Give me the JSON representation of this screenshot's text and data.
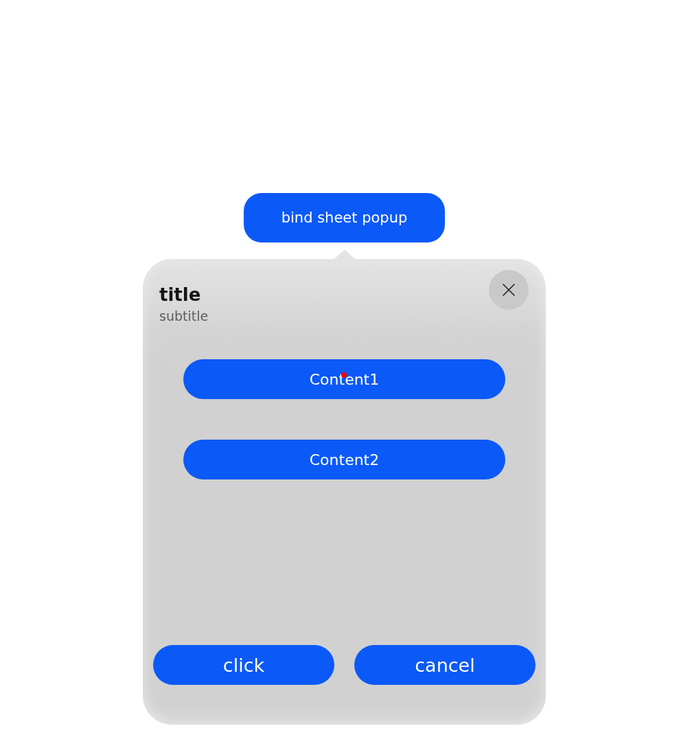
{
  "trigger_button": {
    "label": "bind sheet popup"
  },
  "sheet": {
    "title": "title",
    "subtitle": "subtitle",
    "content_buttons": [
      {
        "label": "Content1",
        "touch_point": true
      },
      {
        "label": "Content2",
        "touch_point": false
      }
    ],
    "footer_buttons": [
      {
        "label": "click"
      },
      {
        "label": "cancel"
      }
    ]
  }
}
